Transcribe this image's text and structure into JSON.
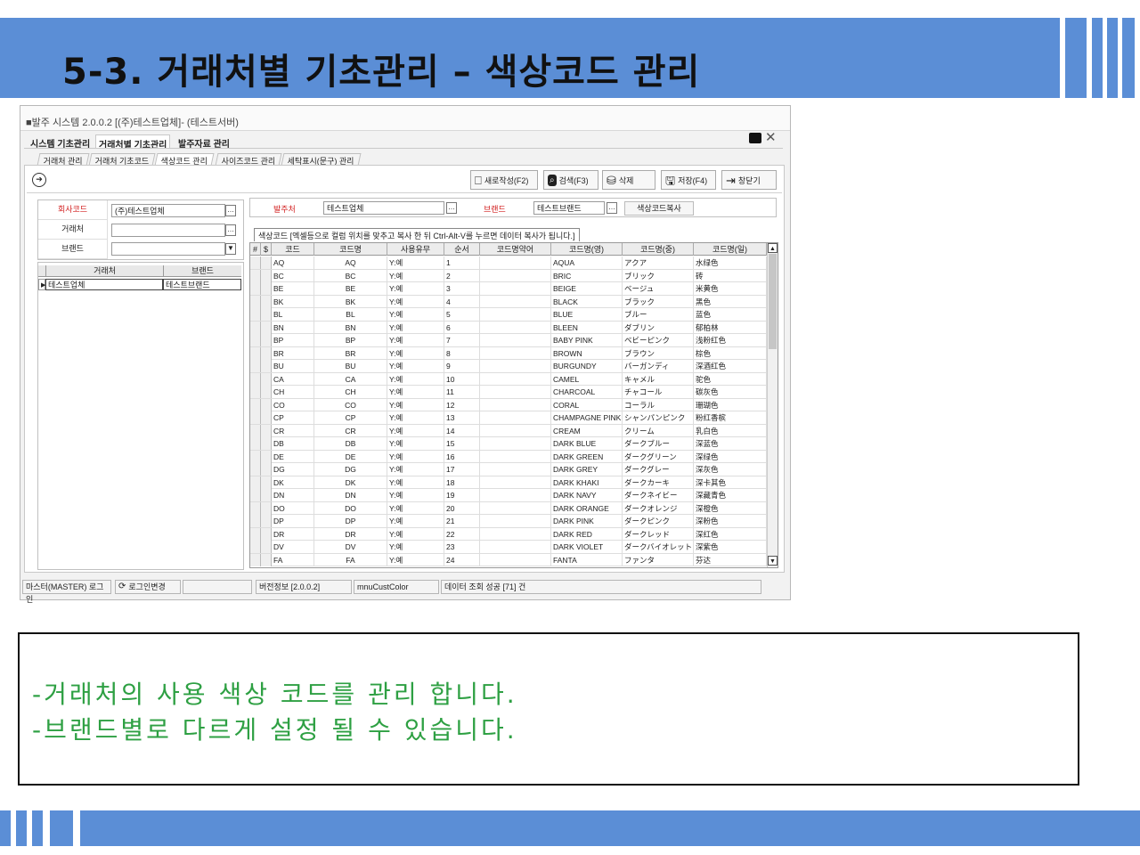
{
  "slide": {
    "title": "5-3. 거래처별 기초관리 – 색상코드 관리",
    "description": [
      "-거래처의 사용 색상 코드를 관리 합니다.",
      "-브랜드별로 다르게 설정 될 수 있습니다."
    ],
    "accent_color": "#5b8ed6",
    "description_color": "#2ea043"
  },
  "app": {
    "title": "■발주 시스템 2.0.0.2 [(주)테스트업체]- (테스트서버)",
    "main_tabs": [
      "시스템 기초관리",
      "거래처별 기초관리",
      "발주자료 관리"
    ],
    "sub_tabs": [
      "거래처 관리",
      "거래처 기초코드",
      "색상코드 관리",
      "사이즈코드 관리",
      "세탁표시(문구) 관리"
    ],
    "toolbar": {
      "new": "새로작성(F2)",
      "search": "검색(F3)",
      "delete": "삭제",
      "save": "저장(F4)",
      "close": "창닫기"
    },
    "left_form": {
      "company_label": "회사코드",
      "company_value": "(주)테스트업체",
      "customer_label": "거래처",
      "customer_value": "",
      "brand_label": "브랜드",
      "brand_value": ""
    },
    "left_grid": {
      "headers": [
        "거래처",
        "브랜드"
      ],
      "rows": [
        [
          "테스트업체",
          "테스트브랜드"
        ]
      ]
    },
    "right_filter": {
      "orderer_label": "발주처",
      "orderer_value": "테스트업체",
      "brand_label": "브랜드",
      "brand_value": "테스트브랜드",
      "copy_button": "색상코드복사"
    },
    "grid_tab": "색상코드 [엑셀등으로 컬럼 위치를 맞추고 복사 한 뒤 Ctrl-Alt-V를 누르면 데이터 복사가 됩니다.]",
    "grid_headers": [
      "코드",
      "코드명",
      "사용유무",
      "순서",
      "코드명약어",
      "코드명(영)",
      "코드명(중)",
      "코드명(일)"
    ],
    "grid_rows": [
      [
        "AQ",
        "AQ",
        "Y:예",
        "1",
        "",
        "AQUA",
        "アクア",
        "水绿色"
      ],
      [
        "BC",
        "BC",
        "Y:예",
        "2",
        "",
        "BRIC",
        "ブリック",
        "砖"
      ],
      [
        "BE",
        "BE",
        "Y:예",
        "3",
        "",
        "BEIGE",
        "ベージュ",
        "米黄色"
      ],
      [
        "BK",
        "BK",
        "Y:예",
        "4",
        "",
        "BLACK",
        "ブラック",
        "黑色"
      ],
      [
        "BL",
        "BL",
        "Y:예",
        "5",
        "",
        "BLUE",
        "ブルー",
        "蓝色"
      ],
      [
        "BN",
        "BN",
        "Y:예",
        "6",
        "",
        "BLEEN",
        "ダブリン",
        "郁柏林"
      ],
      [
        "BP",
        "BP",
        "Y:예",
        "7",
        "",
        "BABY PINK",
        "ベビーピンク",
        "浅粉红色"
      ],
      [
        "BR",
        "BR",
        "Y:예",
        "8",
        "",
        "BROWN",
        "ブラウン",
        "棕色"
      ],
      [
        "BU",
        "BU",
        "Y:예",
        "9",
        "",
        "BURGUNDY",
        "バーガンディ",
        "深酒红色"
      ],
      [
        "CA",
        "CA",
        "Y:예",
        "10",
        "",
        "CAMEL",
        "キャメル",
        "驼色"
      ],
      [
        "CH",
        "CH",
        "Y:예",
        "11",
        "",
        "CHARCOAL",
        "チャコール",
        "碳灰色"
      ],
      [
        "CO",
        "CO",
        "Y:예",
        "12",
        "",
        "CORAL",
        "コーラル",
        "珊瑚色"
      ],
      [
        "CP",
        "CP",
        "Y:예",
        "13",
        "",
        "CHAMPAGNE PINK",
        "シャンパンピンク",
        "粉红香槟"
      ],
      [
        "CR",
        "CR",
        "Y:예",
        "14",
        "",
        "CREAM",
        "クリーム",
        "乳白色"
      ],
      [
        "DB",
        "DB",
        "Y:예",
        "15",
        "",
        "DARK BLUE",
        "ダークブルー",
        "深蓝色"
      ],
      [
        "DE",
        "DE",
        "Y:예",
        "16",
        "",
        "DARK GREEN",
        "ダークグリーン",
        "深绿色"
      ],
      [
        "DG",
        "DG",
        "Y:예",
        "17",
        "",
        "DARK GREY",
        "ダークグレー",
        "深灰色"
      ],
      [
        "DK",
        "DK",
        "Y:예",
        "18",
        "",
        "DARK KHAKI",
        "ダークカーキ",
        "深卡其色"
      ],
      [
        "DN",
        "DN",
        "Y:예",
        "19",
        "",
        "DARK NAVY",
        "ダークネイビー",
        "深藏青色"
      ],
      [
        "DO",
        "DO",
        "Y:예",
        "20",
        "",
        "DARK ORANGE",
        "ダークオレンジ",
        "深橙色"
      ],
      [
        "DP",
        "DP",
        "Y:예",
        "21",
        "",
        "DARK PINK",
        "ダークピンク",
        "深粉色"
      ],
      [
        "DR",
        "DR",
        "Y:예",
        "22",
        "",
        "DARK RED",
        "ダークレッド",
        "深红色"
      ],
      [
        "DV",
        "DV",
        "Y:예",
        "23",
        "",
        "DARK VIOLET",
        "ダークバイオレット",
        "深紫色"
      ],
      [
        "FA",
        "FA",
        "Y:예",
        "24",
        "",
        "FANTA",
        "ファンタ",
        "芬达"
      ]
    ],
    "statusbar": {
      "login": "마스터(MASTER) 로그인",
      "change_login": "로그인변경",
      "version": "버전정보 [2.0.0.2]",
      "menu": "mnuCustColor",
      "message": "데이터 조회 성공 [71] 건"
    }
  }
}
